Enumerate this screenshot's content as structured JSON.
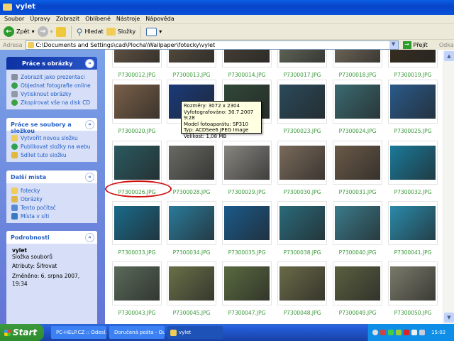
{
  "window": {
    "title": "vylet"
  },
  "menu": [
    "Soubor",
    "Úpravy",
    "Zobrazit",
    "Oblíbené",
    "Nástroje",
    "Nápověda"
  ],
  "toolbar": {
    "back": "Zpět",
    "search": "Hledat",
    "folders": "Složky"
  },
  "address": {
    "label": "Adresa",
    "path": "C:\\Documents and Settings\\cad\\Plocha\\Wallpaper\\fotecky\\vylet",
    "go": "Přejít",
    "links": "Odkazy"
  },
  "panels": {
    "pictures": {
      "title": "Práce s obrázky",
      "items": [
        "Zobrazit jako prezentaci",
        "Objednat fotografie online",
        "Vytisknout obrázky",
        "Zkopírovat vše na disk CD"
      ]
    },
    "files": {
      "title": "Práce se soubory a složkou",
      "items": [
        "Vytvořit novou složku",
        "Publikovat složky na webu",
        "Sdílet tuto složku"
      ]
    },
    "places": {
      "title": "Další místa",
      "items": [
        "fotecky",
        "Obrázky",
        "Tento počítač",
        "Místa v síti"
      ]
    },
    "details": {
      "title": "Podrobnosti",
      "name": "vylet",
      "type": "Složka souborů",
      "attributes": "Atributy: Šifrovat",
      "modified": "Změněno: 6. srpna 2007, 19:34"
    }
  },
  "thumbnails": [
    [
      {
        "name": "P7300012.JPG",
        "color": "#6b5a48"
      },
      {
        "name": "P7300013.JPG",
        "color": "#5a5040"
      },
      {
        "name": "P7300014.JPG",
        "color": "#4a4238"
      },
      {
        "name": "P7300017.JPG",
        "color": "#6a7060"
      },
      {
        "name": "P7300018.JPG",
        "color": "#7a7060"
      },
      {
        "name": "P7300019.JPG",
        "color": "#3a3020"
      }
    ],
    [
      {
        "name": "P7300020.JPG",
        "color": "#7a6048"
      },
      {
        "name": "P73",
        "color": "#1a3a7a"
      },
      {
        "name": "",
        "color": "#304838"
      },
      {
        "name": "P7300023.JPG",
        "color": "#2a4a5a"
      },
      {
        "name": "P7300024.JPG",
        "color": "#3a6a70"
      },
      {
        "name": "P7300025.JPG",
        "color": "#2a5a8a"
      }
    ],
    [
      {
        "name": "P7300026.JPG",
        "color": "#2a5a60"
      },
      {
        "name": "P7300028.JPG",
        "color": "#6a6a64"
      },
      {
        "name": "P7300029.JPG",
        "color": "#888680"
      },
      {
        "name": "P7300030.JPG",
        "color": "#7a6a5a"
      },
      {
        "name": "P7300031.JPG",
        "color": "#6a5a48"
      },
      {
        "name": "P7300032.JPG",
        "color": "#1a7a9a"
      }
    ],
    [
      {
        "name": "P7300033.JPG",
        "color": "#1a6a8a"
      },
      {
        "name": "P7300034.JPG",
        "color": "#2a7a9a"
      },
      {
        "name": "P7300035.JPG",
        "color": "#1a5a8a"
      },
      {
        "name": "P7300038.JPG",
        "color": "#2a6a7a"
      },
      {
        "name": "P7300040.JPG",
        "color": "#3a7a8a"
      },
      {
        "name": "P7300041.JPG",
        "color": "#2a8aaa"
      }
    ],
    [
      {
        "name": "P7300043.JPG",
        "color": "#5a6a5a"
      },
      {
        "name": "P7300045.JPG",
        "color": "#6a7048"
      },
      {
        "name": "P7300047.JPG",
        "color": "#5a6a40"
      },
      {
        "name": "P7300048.JPG",
        "color": "#6a6a48"
      },
      {
        "name": "P7300049.JPG",
        "color": "#5a6040"
      },
      {
        "name": "P7300050.JPG",
        "color": "#7a7a6a"
      }
    ]
  ],
  "tooltip": [
    "Rozměry: 3072 x 2304",
    "Vyfotografováno: 30.7.2007 9:28",
    "Model fotoaparátu: SP310",
    "Typ: ACDSee6 JPEG Image",
    "Velikost: 1,08 MB"
  ],
  "taskbar": {
    "start": "Start",
    "tasks": [
      "PC-HELP.CZ :: Odesl...",
      "Doručená pošta - Out...",
      "vylet"
    ],
    "clock": "15:02"
  },
  "highlight_color": "#d01010"
}
